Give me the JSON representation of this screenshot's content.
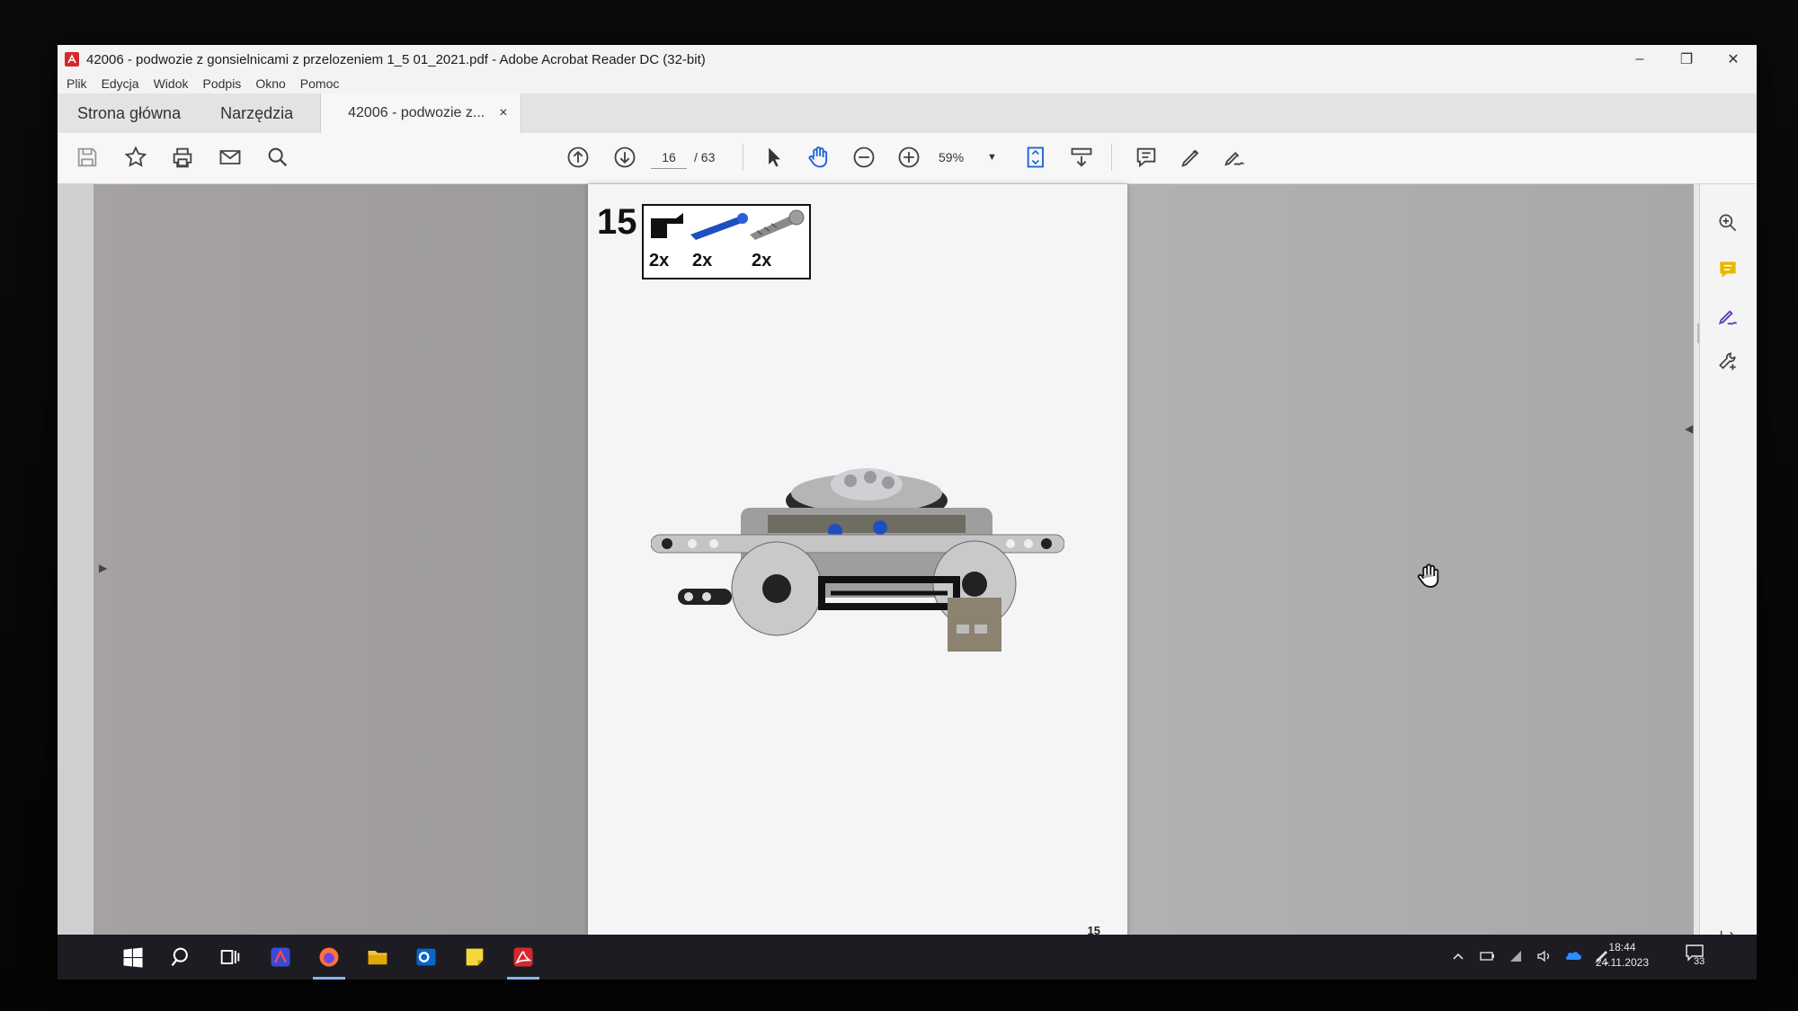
{
  "window": {
    "title": "42006 - podwozie z gonsielnicami z przelozeniem 1_5 01_2021.pdf - Adobe Acrobat Reader DC (32-bit)",
    "minimize": "–",
    "maximize": "❐",
    "close": "✕"
  },
  "menu": {
    "items": [
      "Plik",
      "Edycja",
      "Widok",
      "Podpis",
      "Okno",
      "Pomoc"
    ]
  },
  "tabs": {
    "home": "Strona główna",
    "tools": "Narzędzia",
    "document": "42006 - podwozie z...",
    "close": "×"
  },
  "toolbar": {
    "page_current": "16",
    "page_total": "/ 63",
    "zoom": "59%"
  },
  "document": {
    "step_number": "15",
    "parts": [
      {
        "qty": "2x",
        "color": "#111111"
      },
      {
        "qty": "2x",
        "color": "#1f4fbf"
      },
      {
        "qty": "2x",
        "color": "#8a8a8a"
      }
    ],
    "page_number": "15"
  },
  "taskbar": {
    "time": "18:44",
    "date": "24.11.2023",
    "notifications": "33"
  }
}
